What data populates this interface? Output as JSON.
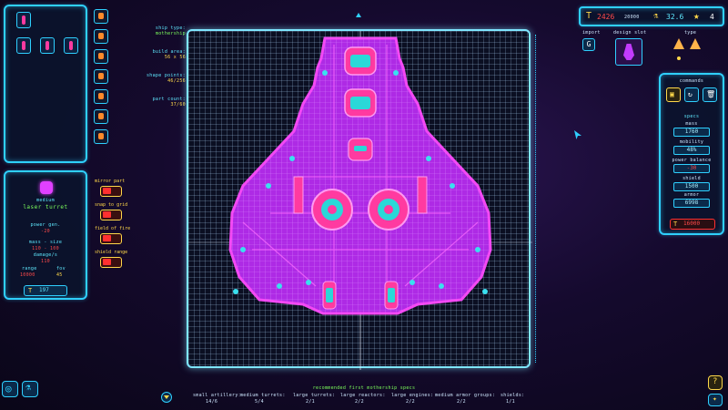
{
  "top_bar": {
    "credits_value": "2426",
    "credits_max": "20000",
    "research_value": "32.6",
    "stars_value": "4"
  },
  "header_labels": {
    "import": "import",
    "design_slot": "design slot",
    "type": "type"
  },
  "ship_info": {
    "ship_type_label": "ship type:",
    "ship_type_value": "mothership",
    "build_area_label": "build area:",
    "build_area_value": "56 x 56",
    "shape_points_label": "shape points:",
    "shape_points_value": "46/256",
    "part_count_label": "part count:",
    "part_count_value": "37/60"
  },
  "part_detail": {
    "size": "medium",
    "name": "laser turret",
    "power_gen_label": "power gen.",
    "power_gen_value": "-20",
    "mass_size_label": "mass - size",
    "mass_size_value": "110 - 100",
    "damage_label": "damage/s",
    "damage_value": "110",
    "range_label": "range",
    "range_value": "10000",
    "fov_label": "fov",
    "fov_value": "45",
    "cost": "197"
  },
  "toggles": [
    {
      "label": "mirror part"
    },
    {
      "label": "snap to grid"
    },
    {
      "label": "field of fire"
    },
    {
      "label": "shield range"
    }
  ],
  "commands": {
    "title": "commands",
    "specs_title": "specs",
    "mass_label": "mass",
    "mass_value": "1760",
    "mobility_label": "mobility",
    "mobility_value": "48%",
    "power_balance_label": "power balance",
    "power_balance_value": "-30",
    "shield_label": "shield",
    "shield_value": "1500",
    "armor_label": "armor",
    "armor_value": "6998",
    "total_cost": "16000"
  },
  "bottom": {
    "recommended": "recommended first mothership specs",
    "requirements": [
      {
        "label": "small artillery:",
        "value": "14/6"
      },
      {
        "label": "medium turrets:",
        "value": "5/4"
      },
      {
        "label": "large turrets:",
        "value": "2/1"
      },
      {
        "label": "large reactors:",
        "value": "2/2"
      },
      {
        "label": "large engines:",
        "value": "2/2"
      },
      {
        "label": "medium armor groups:",
        "value": "2/2"
      },
      {
        "label": "shields:",
        "value": "1/1"
      }
    ]
  },
  "colors": {
    "accent": "#2fd0ff",
    "hull": "#c23bff",
    "warning": "#ffd84a",
    "danger": "#ff3030"
  }
}
